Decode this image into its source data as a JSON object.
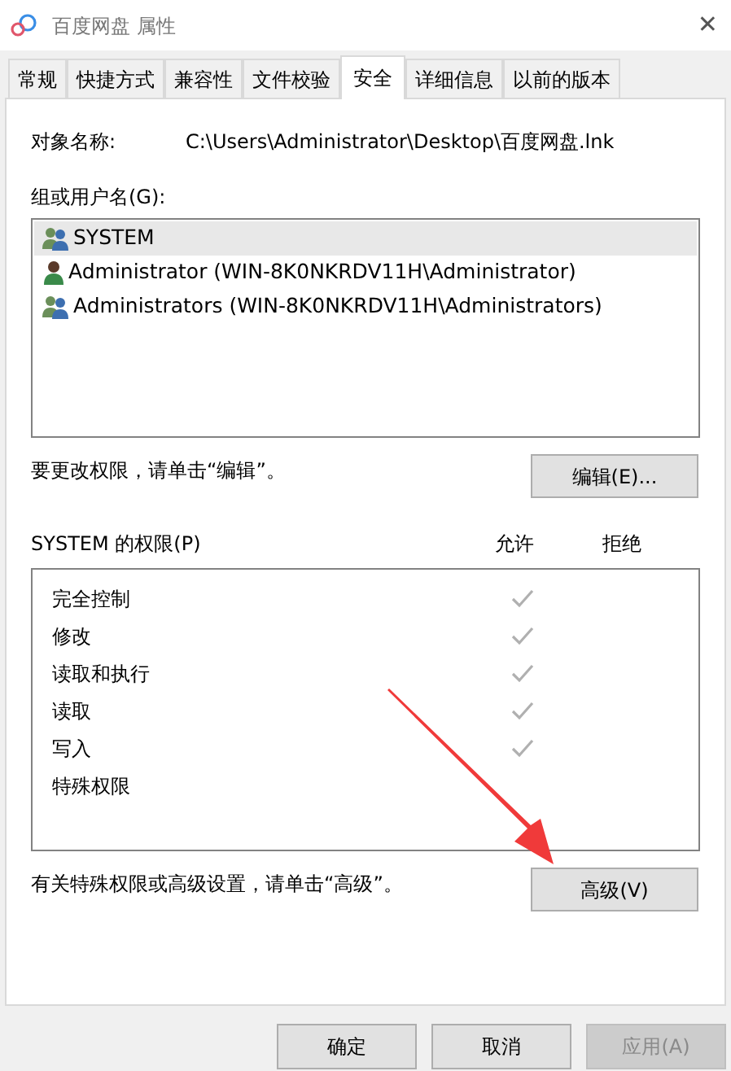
{
  "window": {
    "title": "百度网盘 属性",
    "close": "✕"
  },
  "tabs": [
    {
      "label": "常规",
      "selected": false
    },
    {
      "label": "快捷方式",
      "selected": false
    },
    {
      "label": "兼容性",
      "selected": false
    },
    {
      "label": "文件校验",
      "selected": false
    },
    {
      "label": "安全",
      "selected": true
    },
    {
      "label": "详细信息",
      "selected": false
    },
    {
      "label": "以前的版本",
      "selected": false
    }
  ],
  "object_name": {
    "label": "对象名称:",
    "value": "C:\\Users\\Administrator\\Desktop\\百度网盘.lnk"
  },
  "users": {
    "label": "组或用户名(G):",
    "items": [
      {
        "kind": "group",
        "name": "SYSTEM",
        "selected": true
      },
      {
        "kind": "user",
        "name": "Administrator (WIN-8K0NKRDV11H\\Administrator)",
        "selected": false
      },
      {
        "kind": "group",
        "name": "Administrators (WIN-8K0NKRDV11H\\Administrators)",
        "selected": false
      }
    ]
  },
  "edit_hint": "要更改权限，请单击“编辑”。",
  "edit_button": "编辑(E)...",
  "permissions": {
    "label": "SYSTEM 的权限(P)",
    "allow_header": "允许",
    "deny_header": "拒绝",
    "items": [
      {
        "name": "完全控制",
        "allow": true,
        "deny": false
      },
      {
        "name": "修改",
        "allow": true,
        "deny": false
      },
      {
        "name": "读取和执行",
        "allow": true,
        "deny": false
      },
      {
        "name": "读取",
        "allow": true,
        "deny": false
      },
      {
        "name": "写入",
        "allow": true,
        "deny": false
      },
      {
        "name": "特殊权限",
        "allow": false,
        "deny": false
      }
    ]
  },
  "advanced_hint": "有关特殊权限或高级设置，请单击“高级”。",
  "advanced_button": "高级(V)",
  "buttons": [
    {
      "label": "确定",
      "disabled": false
    },
    {
      "label": "取消",
      "disabled": false
    },
    {
      "label": "应用(A)",
      "disabled": true
    }
  ]
}
